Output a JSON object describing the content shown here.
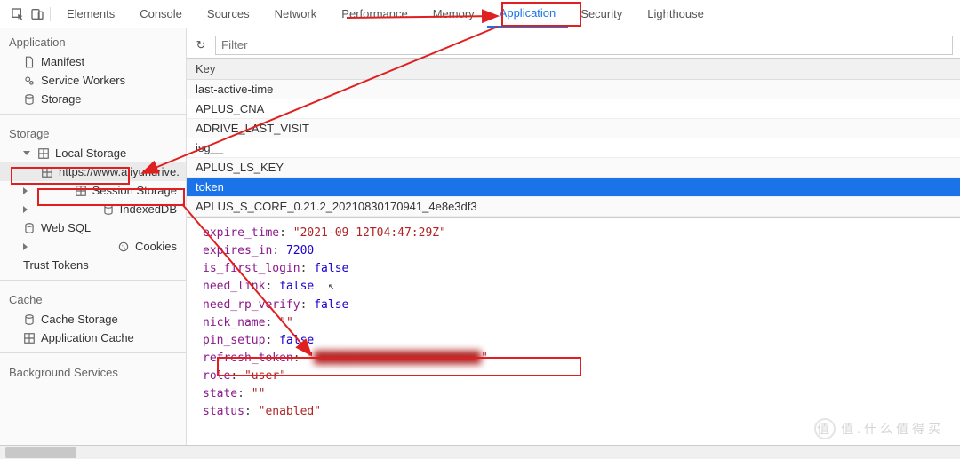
{
  "tabs": {
    "items": [
      "Elements",
      "Console",
      "Sources",
      "Network",
      "Performance",
      "Memory",
      "Application",
      "Security",
      "Lighthouse"
    ],
    "active": "Application"
  },
  "sidebar": {
    "app_title": "Application",
    "app_items": [
      "Manifest",
      "Service Workers",
      "Storage"
    ],
    "storage_title": "Storage",
    "local_storage": "Local Storage",
    "local_storage_origin": "https://www.aliyundrive.",
    "session_storage": "Session Storage",
    "indexeddb": "IndexedDB",
    "websql": "Web SQL",
    "cookies": "Cookies",
    "trust_tokens": "Trust Tokens",
    "cache_title": "Cache",
    "cache_storage": "Cache Storage",
    "app_cache": "Application Cache",
    "bg_title": "Background Services"
  },
  "filter": {
    "placeholder": "Filter"
  },
  "keys": {
    "header": "Key",
    "rows": [
      "last-active-time",
      "APLUS_CNA",
      "ADRIVE_LAST_VISIT",
      "isg__",
      "APLUS_LS_KEY",
      "token",
      "APLUS_S_CORE_0.21.2_20210830170941_4e8e3df3"
    ],
    "selected": "token"
  },
  "detail": {
    "expire_time": "2021-09-12T04:47:29Z",
    "expires_in": 7200,
    "is_first_login": false,
    "need_link": false,
    "need_rp_verify": false,
    "nick_name": "",
    "pin_setup": false,
    "refresh_token": "████████████████████████",
    "role": "user",
    "state": "",
    "status": "enabled"
  },
  "watermark": "值.什么值得买"
}
